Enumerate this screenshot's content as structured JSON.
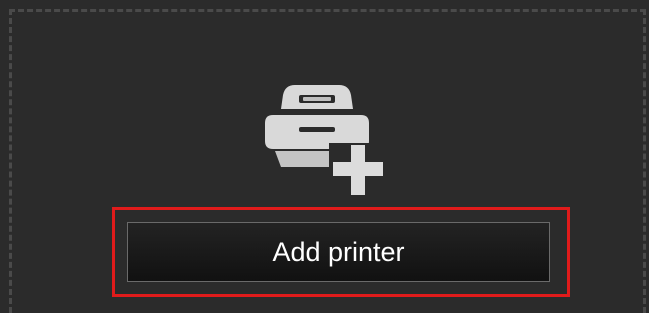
{
  "add_printer": {
    "icon": "printer-add-icon",
    "button_label": "Add printer"
  },
  "colors": {
    "panel_background": "#2b2b2b",
    "dashed_border": "#4a4a4a",
    "highlight": "#e01b1b",
    "button_text": "#ffffff",
    "icon_fill": "#dcdcdc"
  }
}
